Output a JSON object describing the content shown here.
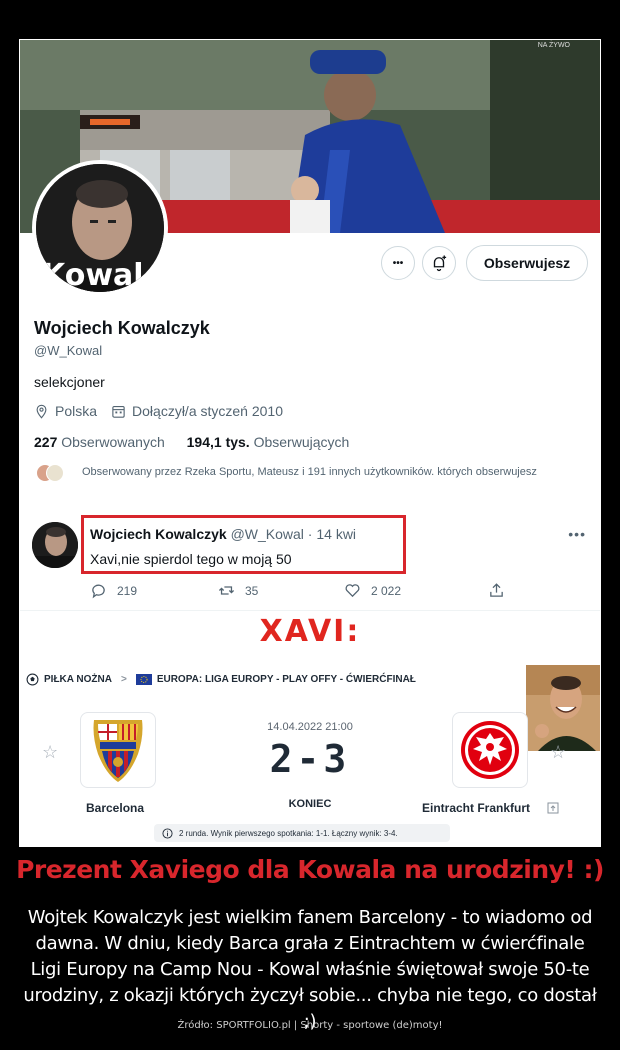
{
  "banner": {
    "tv_logo": "NA ŻYWO"
  },
  "profile": {
    "name": "Wojciech Kowalczyk",
    "handle": "@W_Kowal",
    "bio": "selekcjoner",
    "location": "Polska",
    "joined": "Dołączył/a styczeń 2010",
    "following_count": "227",
    "following_label": "Obserwowanych",
    "followers_count": "194,1 tys.",
    "followers_label": "Obserwujących",
    "followed_by": "Obserwowany przez Rzeka Sportu, Mateusz i 191 innych użytkowników. których obserwujesz",
    "avatar_text": "Kowal",
    "more_label": "•••",
    "follow_button": "Obserwujesz"
  },
  "tweet": {
    "name": "Wojciech Kowalczyk",
    "handle_date": "@W_Kowal · 14 kwi",
    "text": "Xavi,nie spierdol tego w moją 50",
    "more": "•••",
    "replies": "219",
    "retweets": "35",
    "likes": "2 022"
  },
  "xavi_label": "XAVI:",
  "match": {
    "sport": "PIŁKA NOŻNA",
    "separator": ">",
    "competition": "EUROPA: LIGA EUROPY - PLAY OFFY - ĆWIERĆFINAŁ",
    "date": "14.04.2022 21:00",
    "score": "2-3",
    "status": "KONIEC",
    "home": "Barcelona",
    "away": "Eintracht Frankfurt",
    "note": "2 runda. Wynik pierwszego spotkania: 1-1. Łączny wynik: 3-4."
  },
  "caption": {
    "title": "Prezent Xaviego dla Kowala na urodziny! :)",
    "body": "Wojtek Kowalczyk jest wielkim fanem Barcelony - to wiadomo od dawna. W dniu, kiedy Barca grała z Eintrachtem w ćwierćfinale Ligi Europy na Camp Nou - Kowal właśnie świętował swoje 50-te urodziny, z okazji których życzył sobie... chyba nie tego, co dostał ;)",
    "source": "Źródło: SPORTFOLIO.pl | Shorty - sportowe (de)moty!"
  },
  "colors": {
    "red": "#d8262c",
    "twitter_gray": "#536471",
    "text": "#0f1419"
  }
}
